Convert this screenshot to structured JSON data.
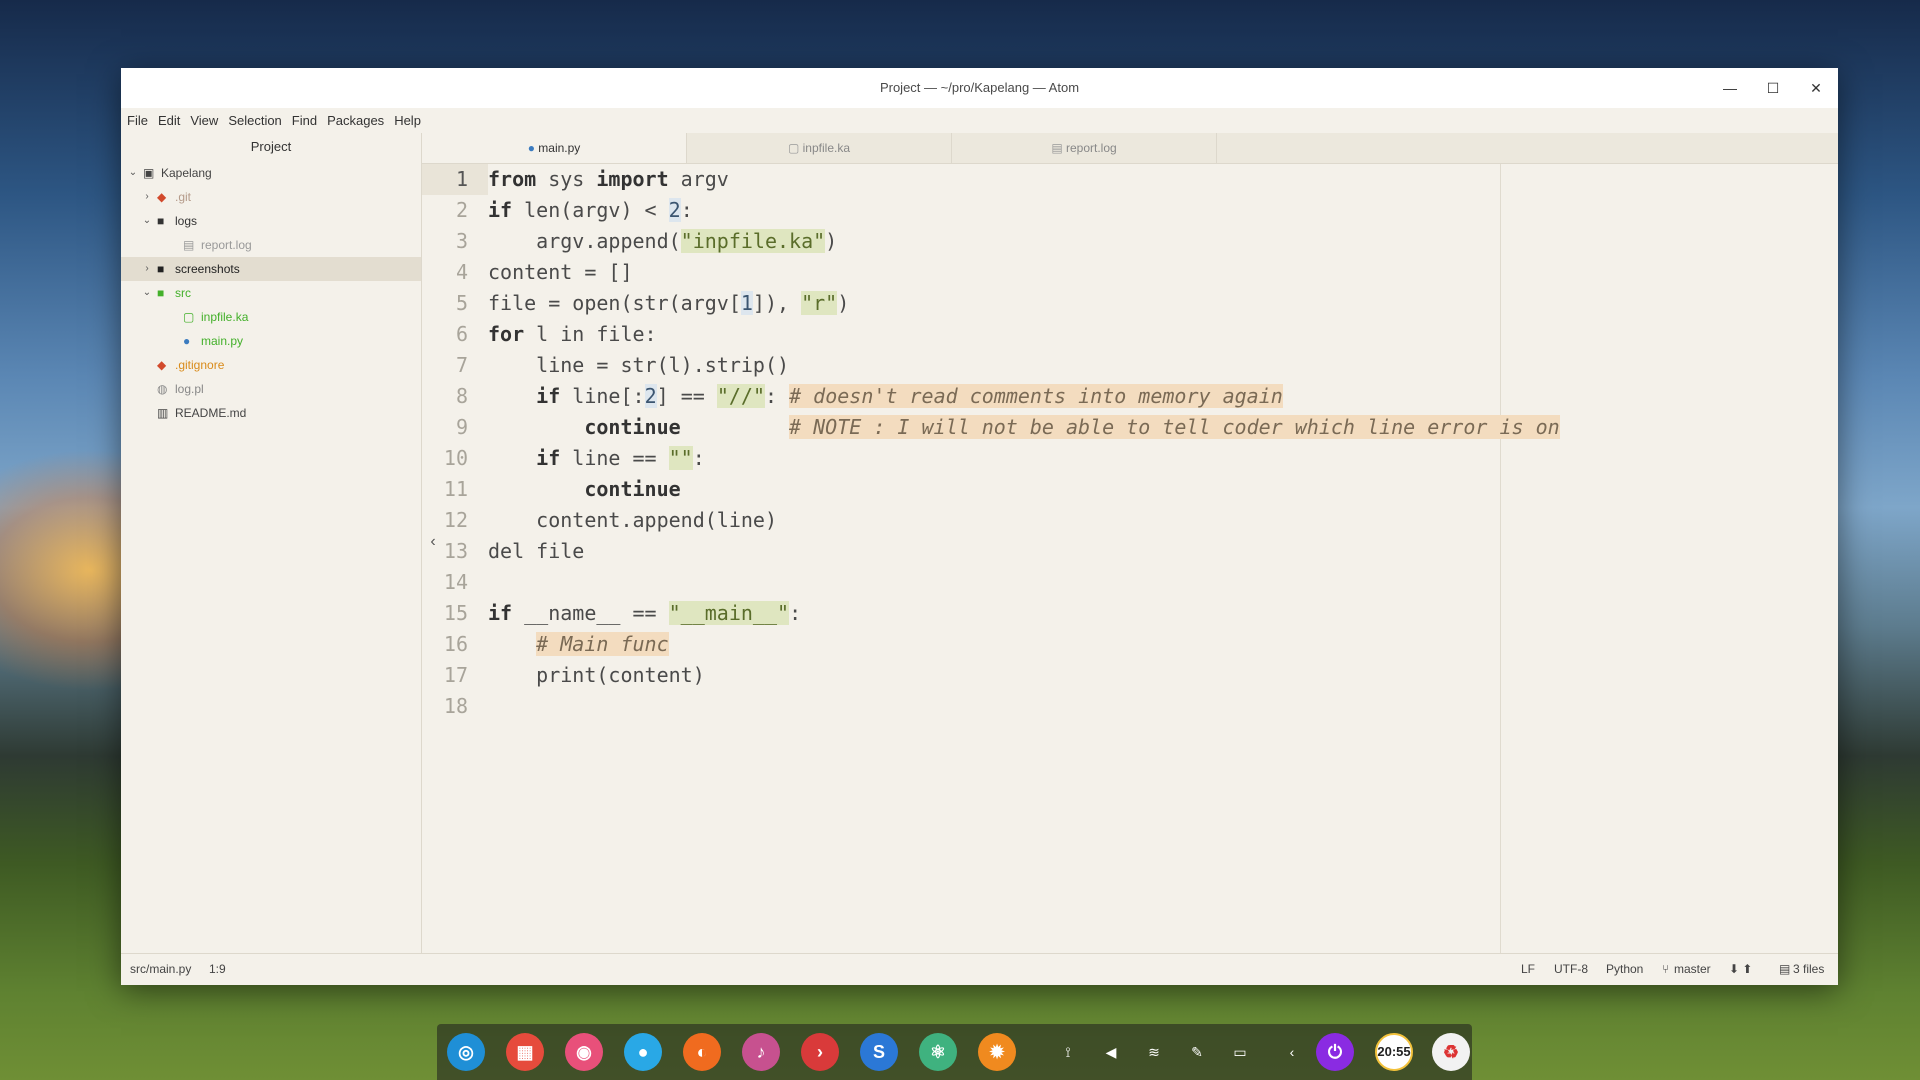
{
  "window": {
    "title": "Project — ~/pro/Kapelang — Atom"
  },
  "window_controls": {
    "minimize": "—",
    "maximize": "☐",
    "close": "✕"
  },
  "menu": [
    "File",
    "Edit",
    "View",
    "Selection",
    "Find",
    "Packages",
    "Help"
  ],
  "tree": {
    "header": "Project",
    "items": [
      {
        "label": "Kapelang",
        "arrow": "⌄",
        "icon": "repo-icon",
        "color": "#444444"
      },
      {
        "label": ".git",
        "arrow": "›",
        "icon": "git-icon",
        "color": "#b59b8a"
      },
      {
        "label": "logs",
        "arrow": "⌄",
        "icon": "folder-icon",
        "color": "#333333"
      },
      {
        "label": "report.log",
        "arrow": "",
        "icon": "file-text-icon",
        "color": "#999999"
      },
      {
        "label": "screenshots",
        "arrow": "›",
        "icon": "folder-icon",
        "color": "#222222"
      },
      {
        "label": "src",
        "arrow": "⌄",
        "icon": "folder-icon",
        "color": "#43b02a"
      },
      {
        "label": "inpfile.ka",
        "arrow": "",
        "icon": "file-icon",
        "color": "#43b02a"
      },
      {
        "label": "main.py",
        "arrow": "",
        "icon": "python-icon",
        "color": "#43b02a"
      },
      {
        "label": ".gitignore",
        "arrow": "",
        "icon": "git-icon",
        "color": "#d98b1a"
      },
      {
        "label": "log.pl",
        "arrow": "",
        "icon": "perl-icon",
        "color": "#888888"
      },
      {
        "label": "README.md",
        "arrow": "",
        "icon": "markdown-icon",
        "color": "#444444"
      }
    ]
  },
  "tabs": [
    {
      "label": "main.py",
      "icon": "python-icon",
      "active": true
    },
    {
      "label": "inpfile.ka",
      "icon": "file-icon",
      "active": false
    },
    {
      "label": "report.log",
      "icon": "file-text-icon",
      "active": false
    }
  ],
  "editor": {
    "line_numbers": [
      "1",
      "2",
      "3",
      "4",
      "5",
      "6",
      "7",
      "8",
      "9",
      "10",
      "11",
      "12",
      "13",
      "14",
      "15",
      "16",
      "17",
      "18"
    ],
    "code": [
      [
        [
          "k",
          "from"
        ],
        [
          "t",
          " sys "
        ],
        [
          "k",
          "import"
        ],
        [
          "t",
          " argv"
        ]
      ],
      [
        [
          "k",
          "if"
        ],
        [
          "t",
          " len(argv) < "
        ],
        [
          "n",
          "2"
        ],
        [
          "t",
          ":"
        ]
      ],
      [
        [
          "t",
          "    argv.append("
        ],
        [
          "s",
          "\"inpfile.ka\""
        ],
        [
          "t",
          ")"
        ]
      ],
      [
        [
          "t",
          "content = []"
        ]
      ],
      [
        [
          "t",
          "file = open(str(argv["
        ],
        [
          "n",
          "1"
        ],
        [
          "t",
          "]), "
        ],
        [
          "s",
          "\"r\""
        ],
        [
          "t",
          ")"
        ]
      ],
      [
        [
          "k",
          "for"
        ],
        [
          "t",
          " l in file:"
        ]
      ],
      [
        [
          "t",
          "    line = str(l).strip()"
        ]
      ],
      [
        [
          "t",
          "    "
        ],
        [
          "k",
          "if"
        ],
        [
          "t",
          " line[:"
        ],
        [
          "n",
          "2"
        ],
        [
          "t",
          "] == "
        ],
        [
          "s",
          "\"//\""
        ],
        [
          "t",
          ": "
        ],
        [
          "c",
          "# doesn't read comments into memory again"
        ]
      ],
      [
        [
          "t",
          "        "
        ],
        [
          "k",
          "continue"
        ],
        [
          "t",
          "         "
        ],
        [
          "c",
          "# NOTE : I will not be able to tell coder which line error is on"
        ]
      ],
      [
        [
          "t",
          "    "
        ],
        [
          "k",
          "if"
        ],
        [
          "t",
          " line == "
        ],
        [
          "s",
          "\"\""
        ],
        [
          "t",
          ":"
        ]
      ],
      [
        [
          "t",
          "        "
        ],
        [
          "k",
          "continue"
        ]
      ],
      [
        [
          "t",
          "    content.append(line)"
        ]
      ],
      [
        [
          "t",
          "del file"
        ]
      ],
      [
        [
          "t",
          ""
        ]
      ],
      [
        [
          "k",
          "if"
        ],
        [
          "t",
          " __name__ == "
        ],
        [
          "s",
          "\"__main__\""
        ],
        [
          "t",
          ":"
        ]
      ],
      [
        [
          "t",
          "    "
        ],
        [
          "c",
          "# Main func"
        ]
      ],
      [
        [
          "t",
          "    print(content)"
        ]
      ],
      [
        [
          "t",
          ""
        ]
      ]
    ]
  },
  "status": {
    "path": "src/main.py",
    "cursor": "1:9",
    "line_ending": "LF",
    "encoding": "UTF-8",
    "grammar": "Python",
    "branch": "master",
    "files": "3 files"
  },
  "dock": {
    "apps": [
      {
        "name": "deepin-launcher-icon",
        "color": "#1f8fd6",
        "glyph": "◎"
      },
      {
        "name": "multitask-view-icon",
        "color": "#e64b3c",
        "glyph": "▦"
      },
      {
        "name": "app-store-icon",
        "color": "#e8507a",
        "glyph": "◉"
      },
      {
        "name": "maps-icon",
        "color": "#29a8e6",
        "glyph": "●"
      },
      {
        "name": "firefox-icon",
        "color": "#f06b1f",
        "glyph": "◐"
      },
      {
        "name": "music-player-icon",
        "color": "#c7518f",
        "glyph": "♪"
      },
      {
        "name": "terminal-icon",
        "color": "#d93a3a",
        "glyph": "›"
      },
      {
        "name": "browser-icon",
        "color": "#2b78d6",
        "glyph": "S"
      },
      {
        "name": "atom-icon",
        "color": "#3fb27f",
        "glyph": "⚛"
      },
      {
        "name": "settings-icon",
        "color": "#f08a1f",
        "glyph": "✹"
      }
    ],
    "tray": [
      {
        "name": "usb-icon",
        "glyph": "⟟"
      },
      {
        "name": "volume-icon",
        "glyph": "◀"
      },
      {
        "name": "wifi-icon",
        "glyph": "≋"
      },
      {
        "name": "pen-icon",
        "glyph": "✎"
      },
      {
        "name": "battery-icon",
        "glyph": "▭"
      },
      {
        "name": "collapse-tray-icon",
        "glyph": "‹"
      }
    ],
    "power_glyph": "⏻",
    "clock": "20:55",
    "trash_glyph": "♻"
  }
}
